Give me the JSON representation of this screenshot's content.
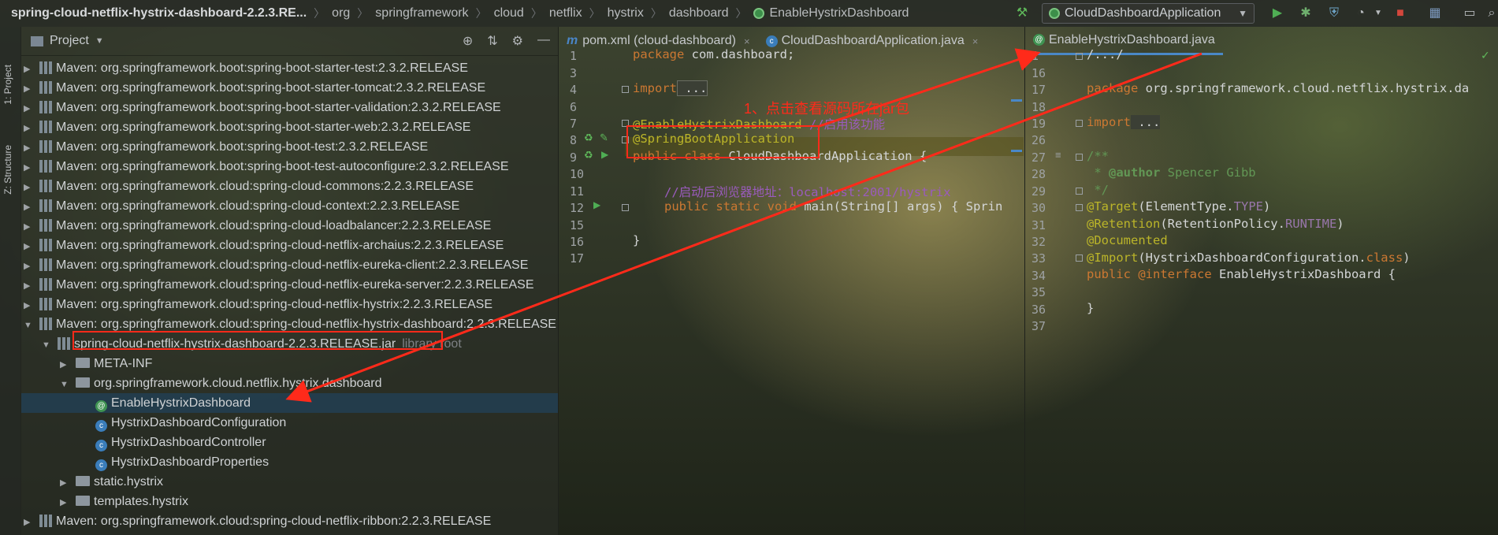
{
  "breadcrumbs": [
    "spring-cloud-netflix-hystrix-dashboard-2.2.3.RE...",
    "org",
    "springframework",
    "cloud",
    "netflix",
    "hystrix",
    "dashboard",
    "EnableHystrixDashboard"
  ],
  "run_config": "CloudDashboardApplication",
  "side_tabs": {
    "project": "1: Project",
    "structure": "Z: Structure"
  },
  "project_panel": {
    "title": "Project",
    "rows": [
      {
        "kind": "lib",
        "arrow": "▶",
        "label": "Maven: org.springframework.boot:spring-boot-starter-test:2.3.2.RELEASE"
      },
      {
        "kind": "lib",
        "arrow": "▶",
        "label": "Maven: org.springframework.boot:spring-boot-starter-tomcat:2.3.2.RELEASE"
      },
      {
        "kind": "lib",
        "arrow": "▶",
        "label": "Maven: org.springframework.boot:spring-boot-starter-validation:2.3.2.RELEASE"
      },
      {
        "kind": "lib",
        "arrow": "▶",
        "label": "Maven: org.springframework.boot:spring-boot-starter-web:2.3.2.RELEASE"
      },
      {
        "kind": "lib",
        "arrow": "▶",
        "label": "Maven: org.springframework.boot:spring-boot-test:2.3.2.RELEASE"
      },
      {
        "kind": "lib",
        "arrow": "▶",
        "label": "Maven: org.springframework.boot:spring-boot-test-autoconfigure:2.3.2.RELEASE"
      },
      {
        "kind": "lib",
        "arrow": "▶",
        "label": "Maven: org.springframework.cloud:spring-cloud-commons:2.2.3.RELEASE"
      },
      {
        "kind": "lib",
        "arrow": "▶",
        "label": "Maven: org.springframework.cloud:spring-cloud-context:2.2.3.RELEASE"
      },
      {
        "kind": "lib",
        "arrow": "▶",
        "label": "Maven: org.springframework.cloud:spring-cloud-loadbalancer:2.2.3.RELEASE"
      },
      {
        "kind": "lib",
        "arrow": "▶",
        "label": "Maven: org.springframework.cloud:spring-cloud-netflix-archaius:2.2.3.RELEASE"
      },
      {
        "kind": "lib",
        "arrow": "▶",
        "label": "Maven: org.springframework.cloud:spring-cloud-netflix-eureka-client:2.2.3.RELEASE"
      },
      {
        "kind": "lib",
        "arrow": "▶",
        "label": "Maven: org.springframework.cloud:spring-cloud-netflix-eureka-server:2.2.3.RELEASE"
      },
      {
        "kind": "lib",
        "arrow": "▶",
        "label": "Maven: org.springframework.cloud:spring-cloud-netflix-hystrix:2.2.3.RELEASE"
      },
      {
        "kind": "lib",
        "arrow": "▼",
        "label": "Maven: org.springframework.cloud:spring-cloud-netflix-hystrix-dashboard:2.2.3.RELEASE"
      },
      {
        "kind": "jar",
        "arrow": "▼",
        "label": "spring-cloud-netflix-hystrix-dashboard-2.2.3.RELEASE.jar",
        "suffix": "library root"
      },
      {
        "kind": "folder",
        "arrow": "▶",
        "label": "META-INF"
      },
      {
        "kind": "folder",
        "arrow": "▼",
        "label": "org.springframework.cloud.netflix.hystrix.dashboard"
      },
      {
        "kind": "anno",
        "arrow": "",
        "label": "EnableHystrixDashboard",
        "selected": true
      },
      {
        "kind": "class",
        "arrow": "",
        "label": "HystrixDashboardConfiguration"
      },
      {
        "kind": "class",
        "arrow": "",
        "label": "HystrixDashboardController"
      },
      {
        "kind": "class",
        "arrow": "",
        "label": "HystrixDashboardProperties"
      },
      {
        "kind": "folder",
        "arrow": "▶",
        "label": "static.hystrix"
      },
      {
        "kind": "folder",
        "arrow": "▶",
        "label": "templates.hystrix"
      },
      {
        "kind": "lib",
        "arrow": "▶",
        "label": "Maven: org.springframework.cloud:spring-cloud-netflix-ribbon:2.2.3.RELEASE"
      }
    ]
  },
  "left_editor": {
    "tabs": [
      {
        "icon": "m",
        "label": "pom.xml (cloud-dashboard)",
        "close": "×"
      },
      {
        "icon": "c",
        "label": "CloudDashboardApplication.java",
        "close": "×"
      }
    ],
    "line_numbers": [
      "1",
      "3",
      "4",
      "6",
      "7",
      "8",
      "9",
      "10",
      "11",
      "12",
      "15",
      "16",
      "17"
    ],
    "code": {
      "l1_kw": "package",
      "l1_rest": " com.dashboard;",
      "l3_kw": "import",
      "l3_rest": " ...",
      "l7_ann": "@EnableHystrixDashboard",
      "l7_com": " //启用该功能",
      "l8_ann": "@SpringBootApplication",
      "l9_kw": "public class",
      "l9_rest": " CloudDashboardApplication {",
      "l11_com": "//启动后浏览器地址：localhost:2001/hystrix",
      "l12_kw": "public static void",
      "l12_rest": " main(String[] args) { Sprin",
      "l16": "}"
    }
  },
  "right_editor": {
    "tab": {
      "label": "EnableHystrixDashboard.java"
    },
    "line_numbers": [
      "1",
      "16",
      "17",
      "18",
      "19",
      "26",
      "27",
      "28",
      "29",
      "30",
      "31",
      "32",
      "33",
      "34",
      "35",
      "36",
      "37"
    ],
    "code": {
      "l1": "/.../",
      "l17_kw": "package",
      "l17_rest": " org.springframework.cloud.netflix.hystrix.da",
      "l19_kw": "import",
      "l19_rest": " ...",
      "l27": "/**",
      "l28_pre": " * ",
      "l28_tag": "@author",
      "l28_rest": " Spencer Gibb",
      "l29": " */",
      "l30_ann": "@Target",
      "l30_a": "(ElementType.",
      "l30_b": "TYPE",
      "l30_c": ")",
      "l31_ann": "@Retention",
      "l31_a": "(RetentionPolicy.",
      "l31_b": "RUNTIME",
      "l31_c": ")",
      "l32_ann": "@Documented",
      "l33_ann": "@Import",
      "l33_a": "(HystrixDashboardConfiguration.",
      "l33_b": "class",
      "l33_c": ")",
      "l34_kw": "public",
      "l34_ann": " @interface",
      "l34_rest": " EnableHystrixDashboard {",
      "l36": "}"
    }
  },
  "annotation": {
    "text": "1、点击查看源码所在jar包",
    "color": "#ff2a1a"
  }
}
